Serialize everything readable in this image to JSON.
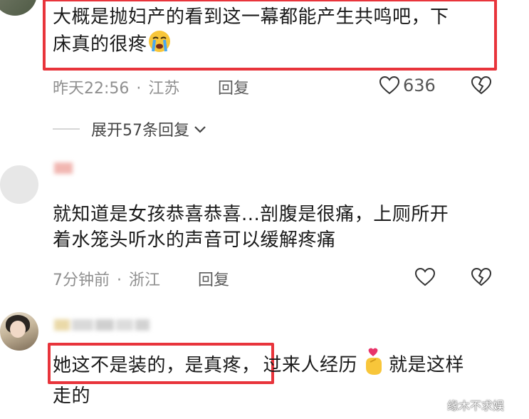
{
  "comments": [
    {
      "text_line1": "大概是抛妇产的看到这一幕都能产生共鸣吧，下",
      "text_line2": "床真的很疼",
      "emoji": "crying-face",
      "time": "昨天22:56",
      "location": "江苏",
      "reply_label": "回复",
      "likes": "636",
      "expand_label": "展开57条回复"
    },
    {
      "text_line1": "就知道是女孩恭喜恭喜...剖腹是很痛，上厕所开",
      "text_line2": "着水笼头听水的声音可以缓解疼痛",
      "time": "7分钟前",
      "location": "浙江",
      "reply_label": "回复"
    },
    {
      "text_highlight": "她这不是装的，是真疼，",
      "text_rest": "过来人经历",
      "text_after_emoji": "就是这样",
      "text_line2": "走的",
      "emoji": "finger-heart"
    }
  ],
  "watermark": "缘木不求娱",
  "colors": {
    "highlight": "#e8343b",
    "meta": "#8f8f8f"
  }
}
